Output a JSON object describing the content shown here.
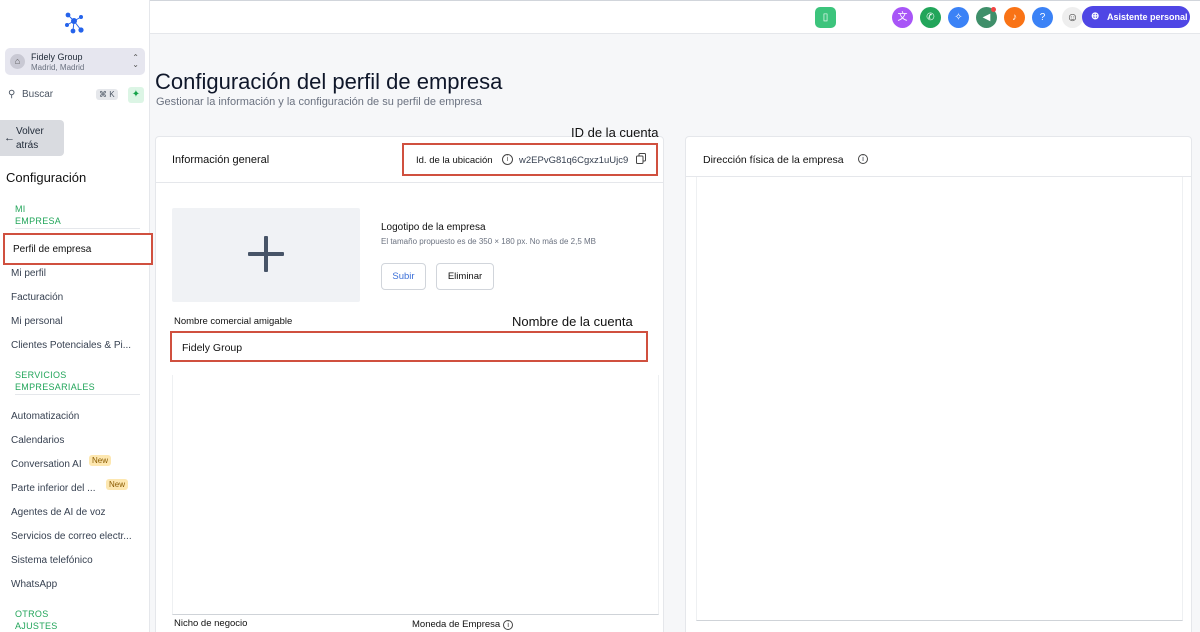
{
  "sidebar": {
    "account": {
      "name": "Fidely Group",
      "location": "Madrid, Madrid"
    },
    "search": {
      "label": "Buscar",
      "shortcut": "⌘ K"
    },
    "back": {
      "line1": "Volver",
      "line2": "atrás"
    },
    "title": "Configuración",
    "sections": {
      "mi_empresa": {
        "line1": "MI",
        "line2": "EMPRESA"
      },
      "servicios": {
        "line1": "SERVICIOS",
        "line2": "EMPRESARIALES"
      },
      "otros": {
        "line1": "OTROS",
        "line2": "AJUSTES"
      }
    },
    "items": [
      "Perfil de empresa",
      "Mi perfil",
      "Facturación",
      "Mi personal",
      "Clientes Potenciales & Pi...",
      "Automatización",
      "Calendarios",
      "Conversation AI",
      "Parte inferior del ...",
      "Agentes de AI de voz",
      "Servicios de correo electr...",
      "Sistema telefónico",
      "WhatsApp"
    ],
    "badge_new": "New"
  },
  "topbar": {
    "assistant": "Asistente personal",
    "help": "?",
    "colors": {
      "phone_green": "#3cc47c",
      "translate": "#a855f7",
      "call": "#22a55a",
      "sparkle": "#3b82f6",
      "megaphone": "#3f8f6a",
      "bell": "#f97316",
      "help": "#3b82f6",
      "assistant": "#4f46e5"
    }
  },
  "page": {
    "title": "Configuración del perfil de empresa",
    "subtitle": "Gestionar la información y la configuración de su perfil de empresa"
  },
  "annotations": {
    "account_id": "ID de la cuenta",
    "account_name": "Nombre de la cuenta"
  },
  "general": {
    "title": "Información general",
    "location_label": "Id. de la ubicación",
    "location_id": "w2EPvG81q6Cgxz1uUjc9",
    "logo_title": "Logotipo de la empresa",
    "logo_hint": "El tamaño propuesto es de 350 × 180 px. No más de 2,5 MB",
    "upload_btn": "Subir",
    "delete_btn": "Eliminar",
    "friendly_name_label": "Nombre comercial amigable",
    "friendly_name_value": "Fidely Group",
    "niche_label": "Nicho de negocio",
    "currency_label": "Moneda de Empresa"
  },
  "address": {
    "title": "Dirección física de la empresa"
  }
}
